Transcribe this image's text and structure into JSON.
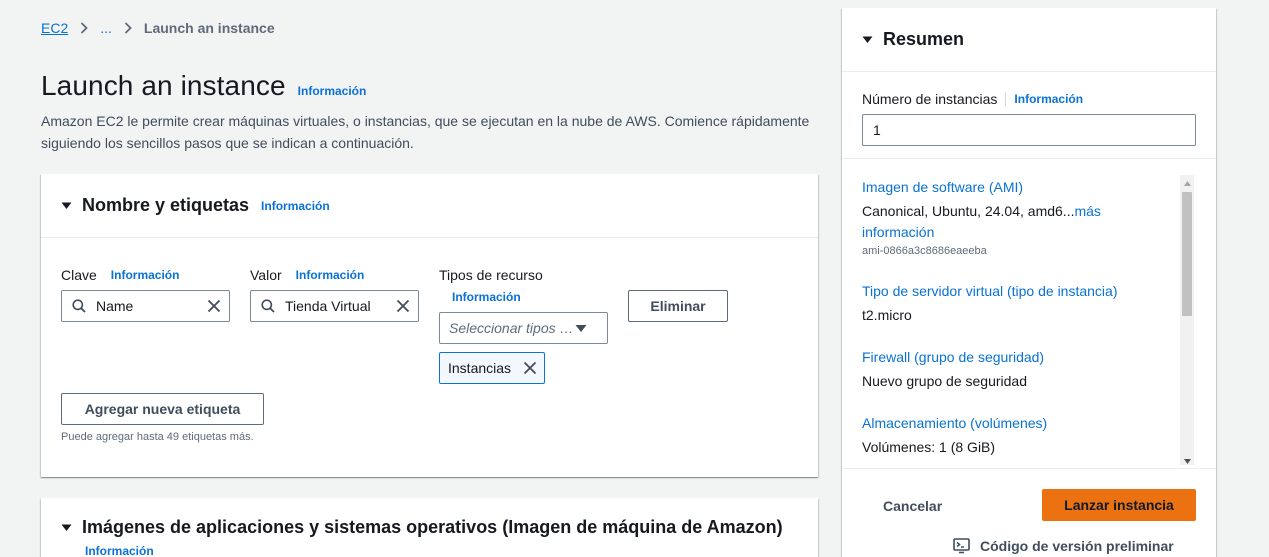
{
  "breadcrumb": {
    "root": "EC2",
    "ellipsis": "...",
    "current": "Launch an instance"
  },
  "page": {
    "title": "Launch an instance",
    "info_label": "Información",
    "description": "Amazon EC2 le permite crear máquinas virtuales, o instancias, que se ejecutan en la nube de AWS. Comience rápidamente siguiendo los sencillos pasos que se indican a continuación."
  },
  "name_tags": {
    "title": "Nombre y etiquetas",
    "info_label": "Información",
    "key_label": "Clave",
    "key_info": "Información",
    "key_value": "Name",
    "value_label": "Valor",
    "value_info": "Información",
    "value_value": "Tienda Virtual",
    "resource_types_label": "Tipos de recurso",
    "resource_types_info": "Información",
    "resource_select_placeholder": "Seleccionar tipos de recurso",
    "resource_token": "Instancias",
    "remove_button": "Eliminar",
    "add_tag_button": "Agregar nueva etiqueta",
    "hint": "Puede agregar hasta 49 etiquetas más."
  },
  "ami_panel": {
    "title": "Imágenes de aplicaciones y sistemas operativos (Imagen de máquina de Amazon)",
    "info_label": "Información"
  },
  "summary": {
    "title": "Resumen",
    "instances_label": "Número de instancias",
    "instances_info": "Información",
    "instances_value": "1",
    "ami_head": "Imagen de software (AMI)",
    "ami_value": "Canonical, Ubuntu, 24.04, amd6...",
    "ami_more_link": "más información",
    "ami_id": "ami-0866a3c8686eaeeba",
    "instance_type_head": "Tipo de servidor virtual (tipo de instancia)",
    "instance_type_value": "t2.micro",
    "firewall_head": "Firewall (grupo de seguridad)",
    "firewall_value": "Nuevo grupo de seguridad",
    "storage_head": "Almacenamiento (volúmenes)",
    "storage_value": "Volúmenes: 1 (8 GiB)",
    "cancel_button": "Cancelar",
    "launch_button": "Lanzar instancia",
    "code_preview": "Código de versión preliminar"
  },
  "colors": {
    "accent_link": "#0972d3",
    "primary_button": "#ec7211",
    "token_border": "#0972d3"
  },
  "icons": [
    "chevron-right-icon",
    "caret-down-icon",
    "search-icon",
    "close-icon",
    "terminal-icon"
  ]
}
